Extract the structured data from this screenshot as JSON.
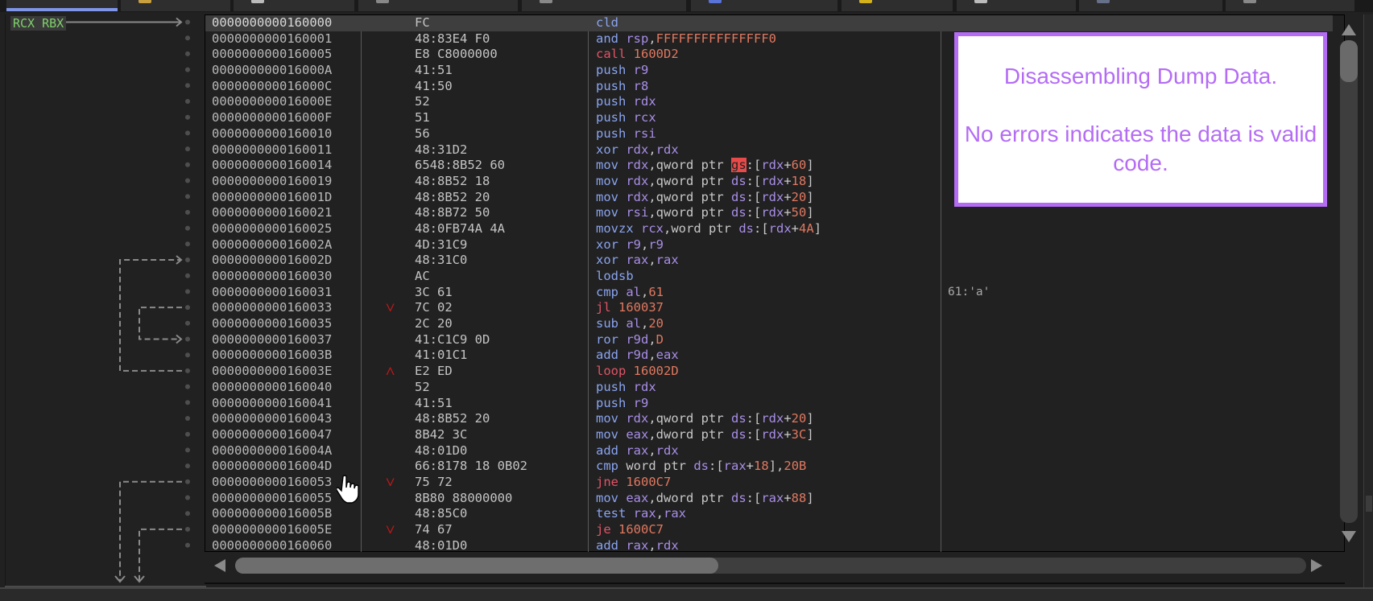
{
  "tabs": [
    {
      "id": "cpu",
      "active": true,
      "icon": "cpu-icon",
      "icon_color": "#7f95e8"
    },
    {
      "id": "log",
      "active": false,
      "icon": "log-icon",
      "icon_color": "#c8a040"
    },
    {
      "id": "notes",
      "active": false,
      "icon": "notes-icon",
      "icon_color": "#bbbbbb"
    },
    {
      "id": "breakpoints",
      "active": false,
      "icon": "breakpoints-icon",
      "icon_color": "#888888"
    },
    {
      "id": "memory-map",
      "active": false,
      "icon": "memory-map-icon",
      "icon_color": "#888888"
    },
    {
      "id": "call-stack",
      "active": false,
      "icon": "call-stack-icon",
      "icon_color": "#5a73d8"
    },
    {
      "id": "seh",
      "active": false,
      "icon": "seh-icon",
      "icon_color": "#d4b21c"
    },
    {
      "id": "script",
      "active": false,
      "icon": "script-icon",
      "icon_color": "#bbbbbb"
    },
    {
      "id": "symbols",
      "active": false,
      "icon": "symbols-icon",
      "icon_color": "#667088"
    },
    {
      "id": "source",
      "active": false,
      "icon": "source-icon",
      "icon_color": "#888888"
    }
  ],
  "gutter": {
    "register_tag": "RCX RBX"
  },
  "listing": {
    "rows": [
      {
        "addr": "0000000000160000",
        "bytes": "FC",
        "jmp": "",
        "asm": [
          [
            "m",
            "cld"
          ]
        ],
        "comment": "",
        "selected": true
      },
      {
        "addr": "0000000000160001",
        "bytes": "48:83E4 F0",
        "jmp": "",
        "asm": [
          [
            "m",
            "and "
          ],
          [
            "r",
            "rsp"
          ],
          [
            "p",
            ","
          ],
          [
            "n",
            "FFFFFFFFFFFFFFF0"
          ]
        ],
        "comment": ""
      },
      {
        "addr": "0000000000160005",
        "bytes": "E8 C8000000",
        "jmp": "",
        "asm": [
          [
            "mc",
            "call "
          ],
          [
            "n",
            "1600D2"
          ]
        ],
        "comment": ""
      },
      {
        "addr": "000000000016000A",
        "bytes": "41:51",
        "jmp": "",
        "asm": [
          [
            "m",
            "push "
          ],
          [
            "r",
            "r9"
          ]
        ],
        "comment": ""
      },
      {
        "addr": "000000000016000C",
        "bytes": "41:50",
        "jmp": "",
        "asm": [
          [
            "m",
            "push "
          ],
          [
            "r",
            "r8"
          ]
        ],
        "comment": ""
      },
      {
        "addr": "000000000016000E",
        "bytes": "52",
        "jmp": "",
        "asm": [
          [
            "m",
            "push "
          ],
          [
            "r",
            "rdx"
          ]
        ],
        "comment": ""
      },
      {
        "addr": "000000000016000F",
        "bytes": "51",
        "jmp": "",
        "asm": [
          [
            "m",
            "push "
          ],
          [
            "r",
            "rcx"
          ]
        ],
        "comment": ""
      },
      {
        "addr": "0000000000160010",
        "bytes": "56",
        "jmp": "",
        "asm": [
          [
            "m",
            "push "
          ],
          [
            "r",
            "rsi"
          ]
        ],
        "comment": ""
      },
      {
        "addr": "0000000000160011",
        "bytes": "48:31D2",
        "jmp": "",
        "asm": [
          [
            "m",
            "xor "
          ],
          [
            "r",
            "rdx"
          ],
          [
            "p",
            ","
          ],
          [
            "r",
            "rdx"
          ]
        ],
        "comment": ""
      },
      {
        "addr": "0000000000160014",
        "bytes": "6548:8B52 60",
        "jmp": "",
        "asm": [
          [
            "m",
            "mov "
          ],
          [
            "r",
            "rdx"
          ],
          [
            "p",
            ",qword ptr "
          ],
          [
            "seghl",
            "gs"
          ],
          [
            "p",
            ":["
          ],
          [
            "r",
            "rdx"
          ],
          [
            "p",
            "+"
          ],
          [
            "n",
            "60"
          ],
          [
            "p",
            "]"
          ]
        ],
        "comment": ""
      },
      {
        "addr": "0000000000160019",
        "bytes": "48:8B52 18",
        "jmp": "",
        "asm": [
          [
            "m",
            "mov "
          ],
          [
            "r",
            "rdx"
          ],
          [
            "p",
            ",qword ptr "
          ],
          [
            "seg",
            "ds"
          ],
          [
            "p",
            ":["
          ],
          [
            "r",
            "rdx"
          ],
          [
            "p",
            "+"
          ],
          [
            "n",
            "18"
          ],
          [
            "p",
            "]"
          ]
        ],
        "comment": ""
      },
      {
        "addr": "000000000016001D",
        "bytes": "48:8B52 20",
        "jmp": "",
        "asm": [
          [
            "m",
            "mov "
          ],
          [
            "r",
            "rdx"
          ],
          [
            "p",
            ",qword ptr "
          ],
          [
            "seg",
            "ds"
          ],
          [
            "p",
            ":["
          ],
          [
            "r",
            "rdx"
          ],
          [
            "p",
            "+"
          ],
          [
            "n",
            "20"
          ],
          [
            "p",
            "]"
          ]
        ],
        "comment": ""
      },
      {
        "addr": "0000000000160021",
        "bytes": "48:8B72 50",
        "jmp": "",
        "asm": [
          [
            "m",
            "mov "
          ],
          [
            "r",
            "rsi"
          ],
          [
            "p",
            ",qword ptr "
          ],
          [
            "seg",
            "ds"
          ],
          [
            "p",
            ":["
          ],
          [
            "r",
            "rdx"
          ],
          [
            "p",
            "+"
          ],
          [
            "n",
            "50"
          ],
          [
            "p",
            "]"
          ]
        ],
        "comment": ""
      },
      {
        "addr": "0000000000160025",
        "bytes": "48:0FB74A 4A",
        "jmp": "",
        "asm": [
          [
            "m",
            "movzx "
          ],
          [
            "r",
            "rcx"
          ],
          [
            "p",
            ",word ptr "
          ],
          [
            "seg",
            "ds"
          ],
          [
            "p",
            ":["
          ],
          [
            "r",
            "rdx"
          ],
          [
            "p",
            "+"
          ],
          [
            "n",
            "4A"
          ],
          [
            "p",
            "]"
          ]
        ],
        "comment": ""
      },
      {
        "addr": "000000000016002A",
        "bytes": "4D:31C9",
        "jmp": "",
        "asm": [
          [
            "m",
            "xor "
          ],
          [
            "r",
            "r9"
          ],
          [
            "p",
            ","
          ],
          [
            "r",
            "r9"
          ]
        ],
        "comment": ""
      },
      {
        "addr": "000000000016002D",
        "bytes": "48:31C0",
        "jmp": "",
        "asm": [
          [
            "m",
            "xor "
          ],
          [
            "r",
            "rax"
          ],
          [
            "p",
            ","
          ],
          [
            "r",
            "rax"
          ]
        ],
        "comment": ""
      },
      {
        "addr": "0000000000160030",
        "bytes": "AC",
        "jmp": "",
        "asm": [
          [
            "m",
            "lodsb"
          ]
        ],
        "comment": ""
      },
      {
        "addr": "0000000000160031",
        "bytes": "3C 61",
        "jmp": "",
        "asm": [
          [
            "m",
            "cmp "
          ],
          [
            "r",
            "al"
          ],
          [
            "p",
            ","
          ],
          [
            "n",
            "61"
          ]
        ],
        "comment": "61:'a'"
      },
      {
        "addr": "0000000000160033",
        "bytes": "7C 02",
        "jmp": "down",
        "asm": [
          [
            "mc",
            "jl "
          ],
          [
            "n",
            "160037"
          ]
        ],
        "comment": ""
      },
      {
        "addr": "0000000000160035",
        "bytes": "2C 20",
        "jmp": "",
        "asm": [
          [
            "m",
            "sub "
          ],
          [
            "r",
            "al"
          ],
          [
            "p",
            ","
          ],
          [
            "n",
            "20"
          ]
        ],
        "comment": ""
      },
      {
        "addr": "0000000000160037",
        "bytes": "41:C1C9 0D",
        "jmp": "",
        "asm": [
          [
            "m",
            "ror "
          ],
          [
            "r",
            "r9d"
          ],
          [
            "p",
            ","
          ],
          [
            "n",
            "D"
          ]
        ],
        "comment": ""
      },
      {
        "addr": "000000000016003B",
        "bytes": "41:01C1",
        "jmp": "",
        "asm": [
          [
            "m",
            "add "
          ],
          [
            "r",
            "r9d"
          ],
          [
            "p",
            ","
          ],
          [
            "r",
            "eax"
          ]
        ],
        "comment": ""
      },
      {
        "addr": "000000000016003E",
        "bytes": "E2 ED",
        "jmp": "up",
        "asm": [
          [
            "mc",
            "loop "
          ],
          [
            "n",
            "16002D"
          ]
        ],
        "comment": ""
      },
      {
        "addr": "0000000000160040",
        "bytes": "52",
        "jmp": "",
        "asm": [
          [
            "m",
            "push "
          ],
          [
            "r",
            "rdx"
          ]
        ],
        "comment": ""
      },
      {
        "addr": "0000000000160041",
        "bytes": "41:51",
        "jmp": "",
        "asm": [
          [
            "m",
            "push "
          ],
          [
            "r",
            "r9"
          ]
        ],
        "comment": ""
      },
      {
        "addr": "0000000000160043",
        "bytes": "48:8B52 20",
        "jmp": "",
        "asm": [
          [
            "m",
            "mov "
          ],
          [
            "r",
            "rdx"
          ],
          [
            "p",
            ",qword ptr "
          ],
          [
            "seg",
            "ds"
          ],
          [
            "p",
            ":["
          ],
          [
            "r",
            "rdx"
          ],
          [
            "p",
            "+"
          ],
          [
            "n",
            "20"
          ],
          [
            "p",
            "]"
          ]
        ],
        "comment": ""
      },
      {
        "addr": "0000000000160047",
        "bytes": "8B42 3C",
        "jmp": "",
        "asm": [
          [
            "m",
            "mov "
          ],
          [
            "r",
            "eax"
          ],
          [
            "p",
            ",dword ptr "
          ],
          [
            "seg",
            "ds"
          ],
          [
            "p",
            ":["
          ],
          [
            "r",
            "rdx"
          ],
          [
            "p",
            "+"
          ],
          [
            "n",
            "3C"
          ],
          [
            "p",
            "]"
          ]
        ],
        "comment": ""
      },
      {
        "addr": "000000000016004A",
        "bytes": "48:01D0",
        "jmp": "",
        "asm": [
          [
            "m",
            "add "
          ],
          [
            "r",
            "rax"
          ],
          [
            "p",
            ","
          ],
          [
            "r",
            "rdx"
          ]
        ],
        "comment": ""
      },
      {
        "addr": "000000000016004D",
        "bytes": "66:8178 18 0B02",
        "jmp": "",
        "asm": [
          [
            "m",
            "cmp "
          ],
          [
            "p",
            "word ptr "
          ],
          [
            "seg",
            "ds"
          ],
          [
            "p",
            ":["
          ],
          [
            "r",
            "rax"
          ],
          [
            "p",
            "+"
          ],
          [
            "n",
            "18"
          ],
          [
            "p",
            "],"
          ],
          [
            "n",
            "20B"
          ]
        ],
        "comment": ""
      },
      {
        "addr": "0000000000160053",
        "bytes": "75 72",
        "jmp": "down",
        "asm": [
          [
            "mc",
            "jne "
          ],
          [
            "n",
            "1600C7"
          ]
        ],
        "comment": ""
      },
      {
        "addr": "0000000000160055",
        "bytes": "8B80 88000000",
        "jmp": "",
        "asm": [
          [
            "m",
            "mov "
          ],
          [
            "r",
            "eax"
          ],
          [
            "p",
            ",dword ptr "
          ],
          [
            "seg",
            "ds"
          ],
          [
            "p",
            ":["
          ],
          [
            "r",
            "rax"
          ],
          [
            "p",
            "+"
          ],
          [
            "n",
            "88"
          ],
          [
            "p",
            "]"
          ]
        ],
        "comment": ""
      },
      {
        "addr": "000000000016005B",
        "bytes": "48:85C0",
        "jmp": "",
        "asm": [
          [
            "m",
            "test "
          ],
          [
            "r",
            "rax"
          ],
          [
            "p",
            ","
          ],
          [
            "r",
            "rax"
          ]
        ],
        "comment": ""
      },
      {
        "addr": "000000000016005E",
        "bytes": "74 67",
        "jmp": "down",
        "asm": [
          [
            "mc",
            "je "
          ],
          [
            "n",
            "1600C7"
          ]
        ],
        "comment": ""
      },
      {
        "addr": "0000000000160060",
        "bytes": "48:01D0",
        "jmp": "",
        "asm": [
          [
            "m",
            "add "
          ],
          [
            "r",
            "rax"
          ],
          [
            "p",
            ","
          ],
          [
            "r",
            "rdx"
          ]
        ],
        "comment": ""
      }
    ]
  },
  "callout": {
    "line1": "Disassembling Dump Data.",
    "line2": "No errors indicates the data is valid code.",
    "color": "#b46cf5"
  },
  "scrollbars": {
    "vertical_position_fraction": 0.0,
    "horizontal_position_fraction": 0.0
  }
}
